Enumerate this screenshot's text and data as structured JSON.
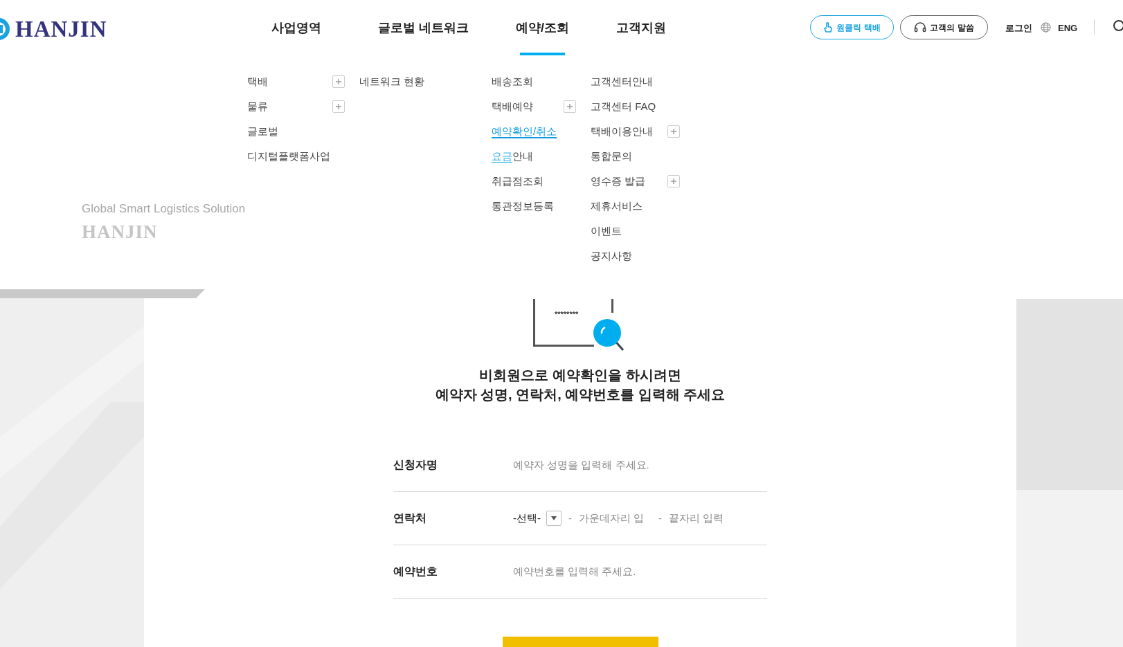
{
  "header": {
    "logo": "HANJIN",
    "nav": [
      {
        "label": "사업영역",
        "selected": false
      },
      {
        "label": "글로벌 네트워크",
        "selected": false
      },
      {
        "label": "예약/조회",
        "selected": true
      },
      {
        "label": "고객지원",
        "selected": false
      }
    ],
    "buttons": [
      {
        "label": "원클릭 택배",
        "kind": "primary"
      },
      {
        "label": "고객의 말씀",
        "kind": "secondary"
      }
    ],
    "login": "로그인",
    "language": "ENG"
  },
  "mega_menu": {
    "columns": [
      [
        {
          "label": "택배",
          "expandable": true,
          "selected": false
        },
        {
          "label": "물류",
          "expandable": true,
          "selected": false
        },
        {
          "label": "글로벌",
          "expandable": false,
          "selected": false
        },
        {
          "label": "디지털플랫폼사업",
          "expandable": false,
          "selected": false
        }
      ],
      [
        {
          "label": "네트워크 현황",
          "expandable": false,
          "selected": false
        }
      ],
      [
        {
          "label": "배송조회",
          "expandable": false,
          "selected": false
        },
        {
          "label": "택배예약",
          "expandable": true,
          "selected": false
        },
        {
          "label": "예약확인/취소",
          "expandable": false,
          "selected": true
        },
        {
          "label": "요금",
          "label_rest": "안내",
          "expandable": false,
          "selected": false
        },
        {
          "label": "취급점조회",
          "expandable": false,
          "selected": false
        },
        {
          "label": "통관정보등록",
          "expandable": false,
          "selected": false
        }
      ],
      [
        {
          "label": "고객센터안내",
          "expandable": false,
          "selected": false
        },
        {
          "label": "고객센터 FAQ",
          "expandable": false,
          "selected": false
        },
        {
          "label": "택배이용안내",
          "expandable": true,
          "selected": false
        },
        {
          "label": "통합문의",
          "expandable": false,
          "selected": false
        },
        {
          "label": "영수증 발급",
          "expandable": true,
          "selected": false
        },
        {
          "label": "제휴서비스",
          "expandable": false,
          "selected": false
        },
        {
          "label": "이벤트",
          "expandable": false,
          "selected": false
        },
        {
          "label": "공지사항",
          "expandable": false,
          "selected": false
        }
      ]
    ],
    "tagline": "Global Smart Logistics Solution",
    "brand": "HANJIN"
  },
  "illustration": {
    "masked_text": "********"
  },
  "intro": [
    "비회원으로 예약확인을 하시려면",
    "예약자 성명, 연락처, 예약번호를 입력해 주세요"
  ],
  "form": [
    {
      "kind": "text",
      "label": "신청자명",
      "placeholder": "예약자 성명을 입력해 주세요."
    },
    {
      "kind": "phone",
      "label": "연락처",
      "select": "-선택-",
      "separator": "-",
      "placeholders": [
        "가운데자리 입",
        "끝자리 입력"
      ]
    },
    {
      "kind": "text",
      "label": "예약번호",
      "placeholder": "예약번호를 입력해 주세요."
    }
  ]
}
